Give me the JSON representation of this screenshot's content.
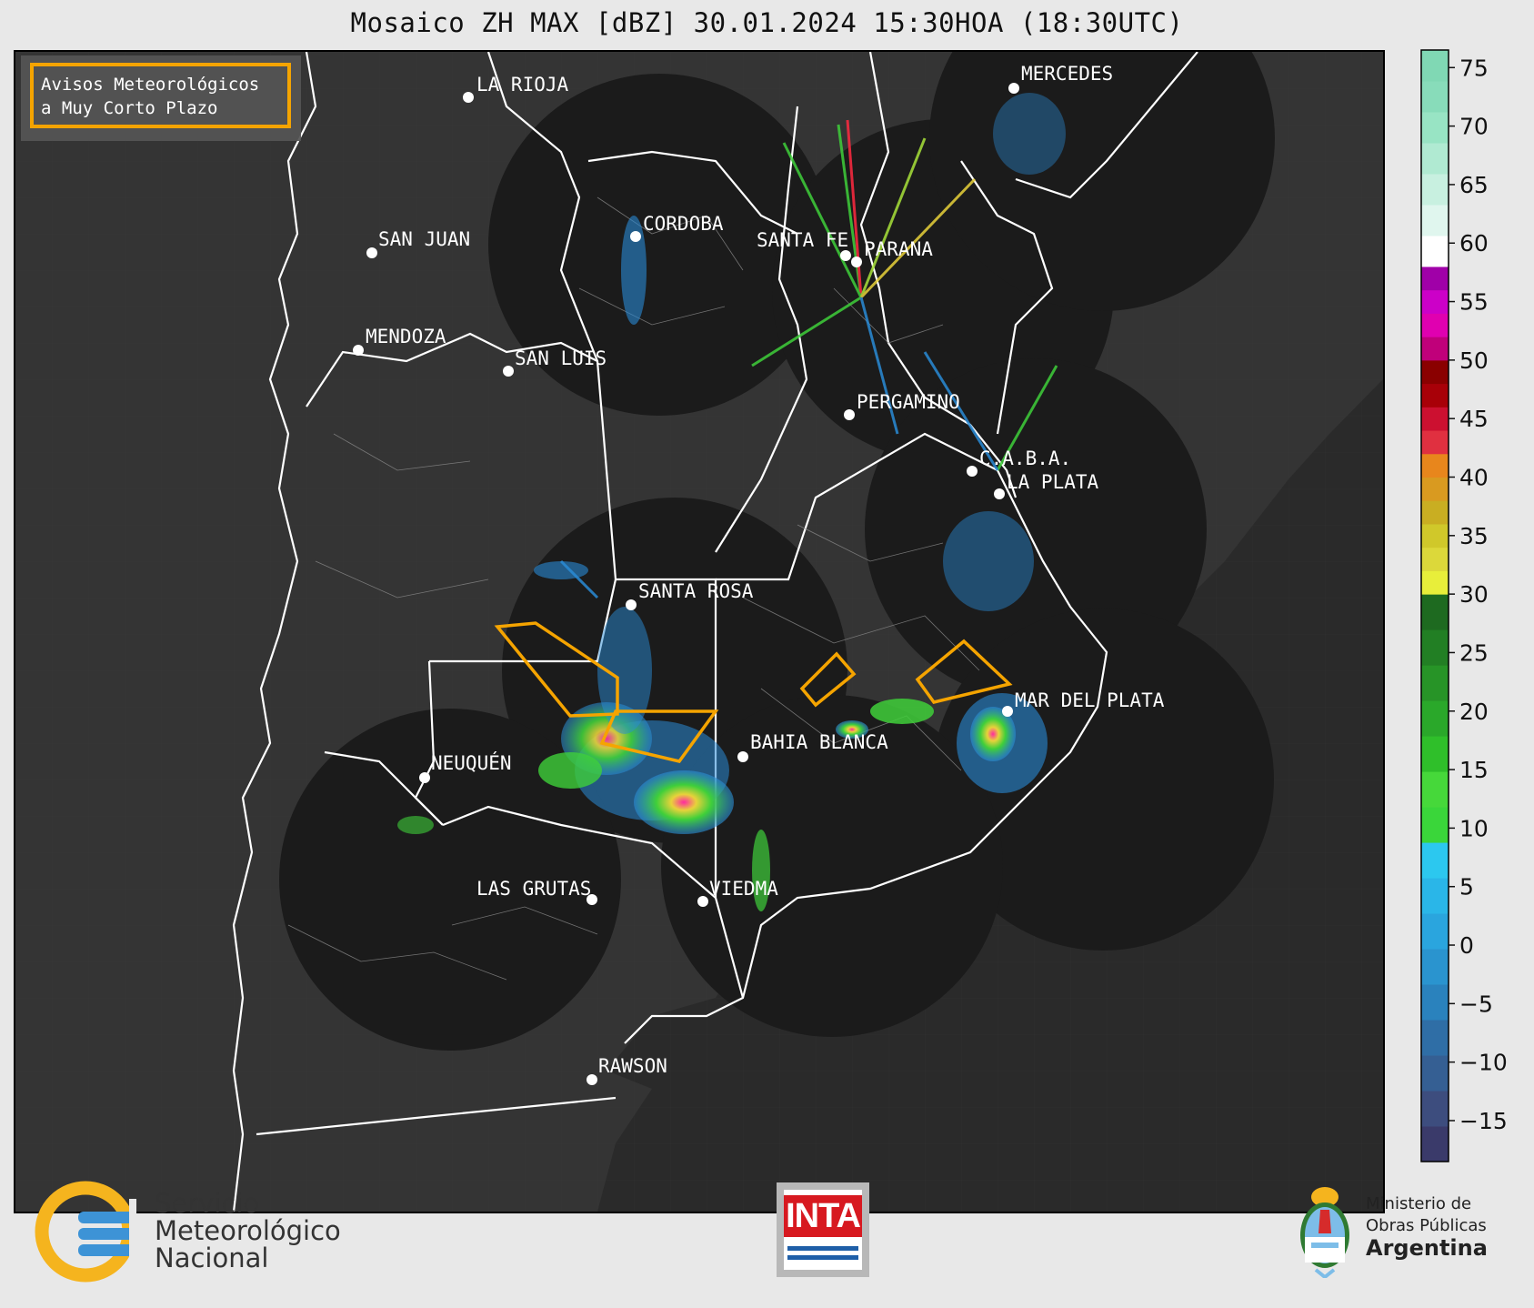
{
  "title": "Mosaico ZH MAX [dBZ] 30.01.2024 15:30HOA (18:30UTC)",
  "legend_box": {
    "line1": "Avisos Meteorológicos",
    "line2": "a Muy Corto Plazo",
    "border_color": "#f5a400"
  },
  "colors": {
    "land": "#333333",
    "sea": "#2a2a2a",
    "radar_disc": "#1b1b1b",
    "boundary": "#ffffff",
    "warning": "#f5a400"
  },
  "cities": [
    {
      "name": "LA RIOJA"
    },
    {
      "name": "CORDOBA"
    },
    {
      "name": "SAN JUAN"
    },
    {
      "name": "SANTA FE"
    },
    {
      "name": "PARANA"
    },
    {
      "name": "MENDOZA"
    },
    {
      "name": "SAN LUIS"
    },
    {
      "name": "PERGAMINO"
    },
    {
      "name": "C.A.B.A."
    },
    {
      "name": "LA PLATA"
    },
    {
      "name": "SANTA ROSA"
    },
    {
      "name": "MAR DEL PLATA"
    },
    {
      "name": "BAHIA BLANCA"
    },
    {
      "name": "NEUQUÉN"
    },
    {
      "name": "LAS GRUTAS"
    },
    {
      "name": "VIEDMA"
    },
    {
      "name": "RAWSON"
    },
    {
      "name": "MERCEDES"
    }
  ],
  "colorbar": {
    "unit": "dBZ",
    "ticks": [
      "75",
      "70",
      "65",
      "60",
      "55",
      "50",
      "45",
      "40",
      "35",
      "30",
      "25",
      "20",
      "15",
      "10",
      "5",
      "0",
      "−5",
      "−10",
      "−15"
    ],
    "tick_values": [
      75,
      70,
      65,
      60,
      55,
      50,
      45,
      40,
      35,
      30,
      25,
      20,
      15,
      10,
      5,
      0,
      -5,
      -10,
      -15
    ],
    "range": [
      -18.5,
      76.5
    ],
    "bands": [
      {
        "from": -18.5,
        "to": 30,
        "scale": "blue"
      },
      {
        "from": 30,
        "to": 58,
        "scale": "warm"
      },
      {
        "from": 58,
        "to": 76.5,
        "scale": "cyan"
      }
    ]
  },
  "footer": {
    "smn": {
      "line1": "Servicio",
      "line2": "Meteorológico",
      "line3": "Nacional"
    },
    "inta": "INTA",
    "mop": {
      "line1": "Ministerio de",
      "line2": "Obras Públicas",
      "line3": "Argentina"
    }
  }
}
